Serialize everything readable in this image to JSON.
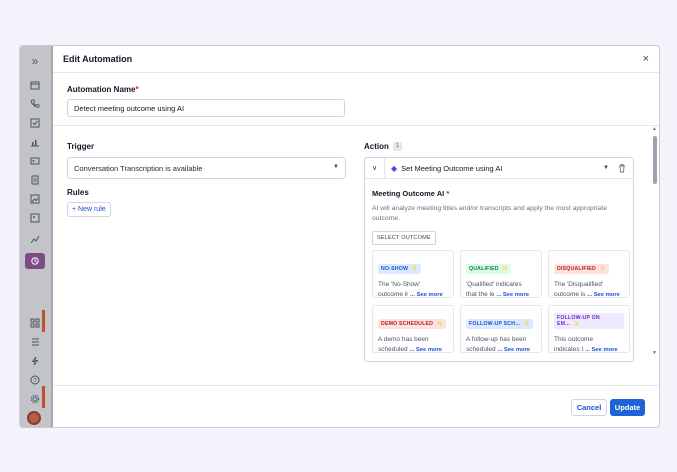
{
  "sidebar": {
    "expand_glyph": "»",
    "icons": [
      "calendar-icon",
      "phone-icon",
      "checkbox-icon",
      "chart-icon",
      "contact-card-icon",
      "document-icon",
      "image-icon",
      "picture-icon",
      "analytics-icon",
      "automation-icon",
      "grid-icon",
      "list-icon",
      "lightning-icon",
      "help-icon",
      "settings-icon",
      "avatar"
    ]
  },
  "header": {
    "title": "Edit Automation",
    "close_glyph": "×"
  },
  "automation_name": {
    "label": "Automation Name",
    "required_mark": "*",
    "value": "Detect meeting outcome using AI"
  },
  "trigger": {
    "label": "Trigger",
    "value": "Conversation Transcription is available"
  },
  "rules": {
    "label": "Rules",
    "new_rule_label": "+ New rule"
  },
  "action": {
    "label": "Action",
    "badge": "1",
    "selected": "Set Meeting Outcome using AI",
    "meeting_outcome": {
      "title": "Meeting Outcome AI",
      "required_mark": "*",
      "description": "AI will analyze meeting titles and/or transcripts and apply the most appropriate outcome.",
      "select_button": "SELECT OUTCOME",
      "see_more": "... See more",
      "cards": [
        {
          "tag": "NO-SHOW",
          "line1": "The 'No-Show'",
          "line2": "outcome ir",
          "color": "#1d4ed8"
        },
        {
          "tag": "QUALIFIED",
          "line1": "'Qualified' indicates",
          "line2": "that the le",
          "color": "#15803d"
        },
        {
          "tag": "DISQUALIFIED",
          "line1": "The 'Disqualified'",
          "line2": "outcome is",
          "color": "#b91c1c"
        },
        {
          "tag": "DEMO SCHEDULED",
          "line1": "A demo has been",
          "line2": "scheduled",
          "color": "#b91c1c"
        },
        {
          "tag": "FOLLOW-UP SCH...",
          "line1": "A follow-up has been",
          "line2": "scheduled",
          "color": "#1d4ed8"
        },
        {
          "tag": "FOLLOW-UP ON EM...",
          "line1": "This outcome",
          "line2": "indicates t",
          "color": "#6d28d9"
        }
      ]
    }
  },
  "footer": {
    "cancel_label": "Cancel",
    "update_label": "Update"
  },
  "colors": {
    "primary": "#1e63d5",
    "rail_active": "#7d4b87",
    "required": "#dc2626"
  }
}
